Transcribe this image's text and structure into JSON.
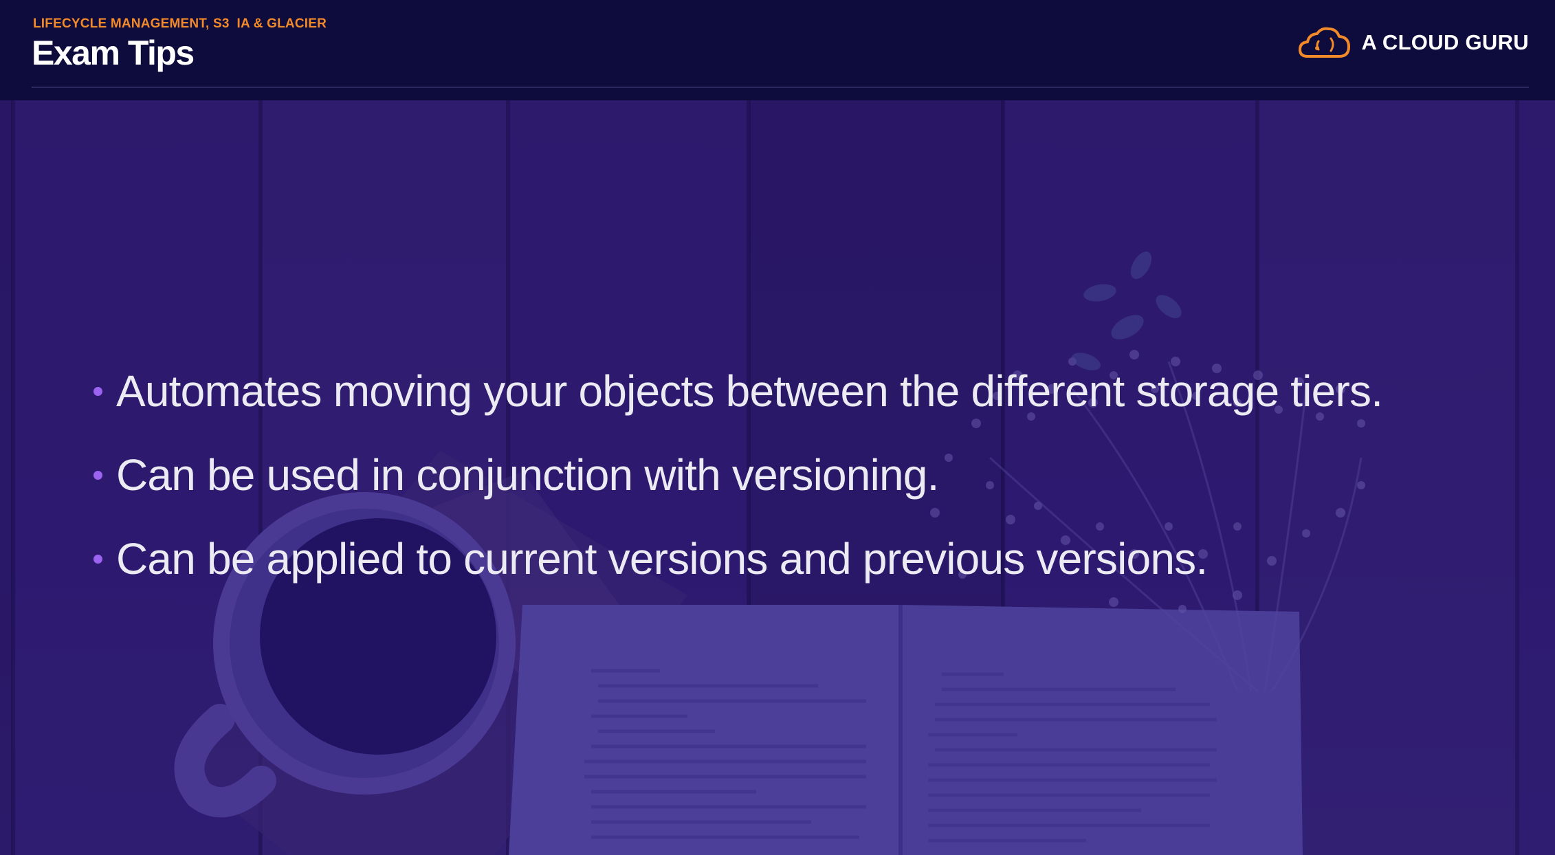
{
  "header": {
    "subtitle": "LIFECYCLE MANAGEMENT, S3  IA & GLACIER",
    "title": "Exam Tips"
  },
  "brand": {
    "name": "A CLOUD GURU",
    "icon": "cloud-logo-icon",
    "accent_color": "#f28a2a"
  },
  "bullets": [
    {
      "text": "Automates moving your objects between the different storage tiers."
    },
    {
      "text": "Can be used in conjunction with versioning."
    },
    {
      "text": "Can be applied to current versions and previous versions."
    }
  ],
  "colors": {
    "header_bg": "#0e0b3d",
    "bullet_dot": "#9b63f0",
    "body_text": "#ecebf3",
    "background_tint": "#2f1c68"
  }
}
